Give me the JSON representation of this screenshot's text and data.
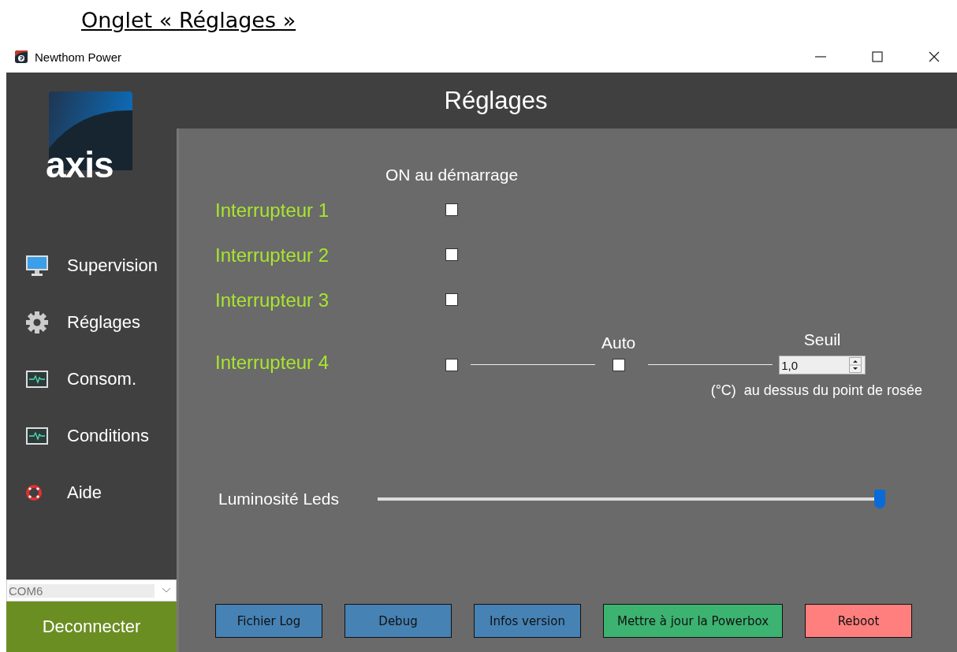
{
  "heading": "Onglet « Réglages »",
  "window": {
    "title": "Newthom Power",
    "page_title": "Réglages"
  },
  "sidebar": {
    "logo": "axis",
    "items": [
      {
        "label": "Supervision",
        "kind": "monitor"
      },
      {
        "label": "Réglages",
        "kind": "gear"
      },
      {
        "label": "Consom.",
        "kind": "chart"
      },
      {
        "label": "Conditions",
        "kind": "chart"
      },
      {
        "label": "Aide",
        "kind": "lifebuoy"
      }
    ],
    "port": {
      "value": "COM6"
    },
    "connect_button": "Deconnecter"
  },
  "switches": {
    "column_label": "ON au démarrage",
    "rows": [
      {
        "label": "Interrupteur 1",
        "checked": false
      },
      {
        "label": "Interrupteur 2",
        "checked": false
      },
      {
        "label": "Interrupteur 3",
        "checked": false
      },
      {
        "label": "Interrupteur 4",
        "checked": false
      }
    ]
  },
  "auto": {
    "label": "Auto",
    "checked": false
  },
  "threshold": {
    "label": "Seuil",
    "value": "1,0",
    "note": "(°C)  au dessus du point de rosée"
  },
  "brightness": {
    "label": "Luminosité Leds",
    "level": 1.0
  },
  "buttons": [
    {
      "label": "Fichier Log",
      "color": "#4682b4"
    },
    {
      "label": "Debug",
      "color": "#4682b4"
    },
    {
      "label": "Infos version",
      "color": "#4682b4"
    },
    {
      "label": "Mettre à jour la Powerbox",
      "color": "#3cb371"
    },
    {
      "label": "Reboot",
      "color": "#ff7f7f"
    }
  ]
}
